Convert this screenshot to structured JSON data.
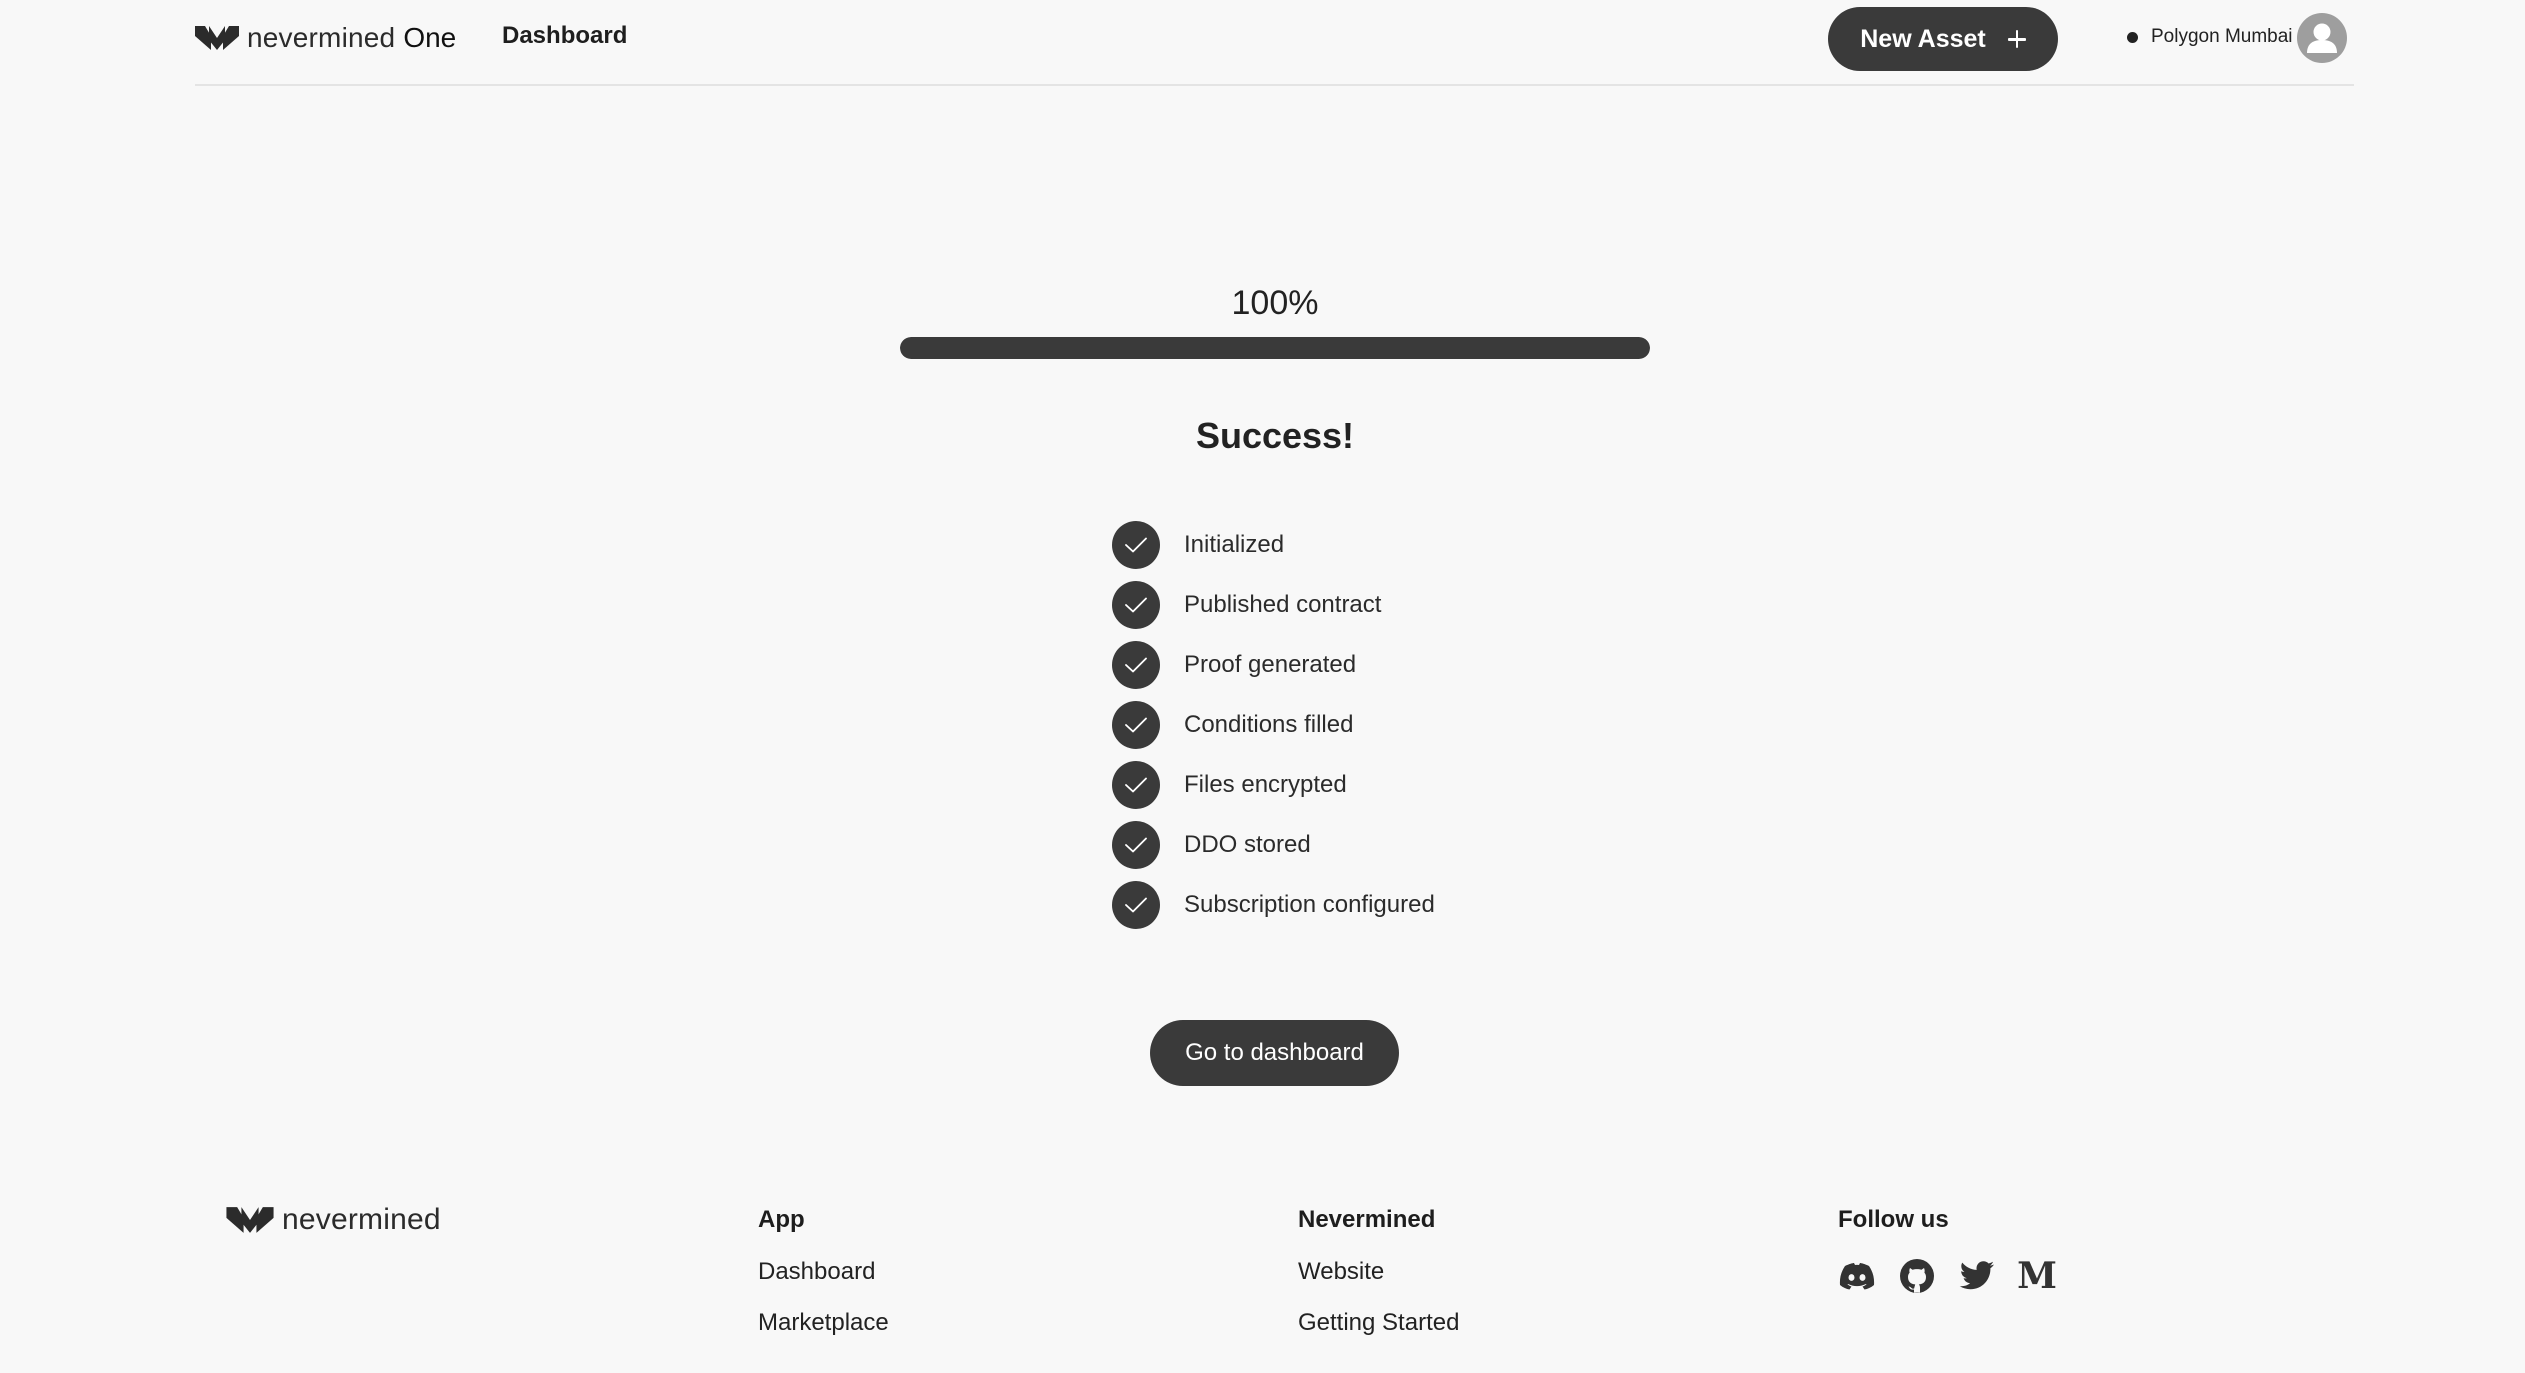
{
  "header": {
    "brand_name": "nevermined",
    "brand_suffix": "One",
    "nav_dashboard": "Dashboard",
    "new_asset_label": "New Asset",
    "network_name": "Polygon Mumbai"
  },
  "main": {
    "progress_percent_label": "100%",
    "progress_value": 1.0,
    "success_title": "Success!",
    "steps": [
      "Initialized",
      "Published contract",
      "Proof generated",
      "Conditions filled",
      "Files encrypted",
      "DDO stored",
      "Subscription configured"
    ],
    "go_to_dashboard_label": "Go to dashboard"
  },
  "footer": {
    "brand_name": "nevermined",
    "app": {
      "heading": "App",
      "links": [
        "Dashboard",
        "Marketplace"
      ]
    },
    "nevermined": {
      "heading": "Nevermined",
      "links": [
        "Website",
        "Getting Started"
      ]
    },
    "follow": {
      "heading": "Follow us",
      "icons": [
        "discord-icon",
        "github-icon",
        "twitter-icon",
        "medium-icon"
      ]
    }
  },
  "colors": {
    "background": "#f8f8f8",
    "primary_dark": "#3a3a3a",
    "avatar_gray": "#9e9e9e",
    "divider": "#e4e4e4"
  }
}
